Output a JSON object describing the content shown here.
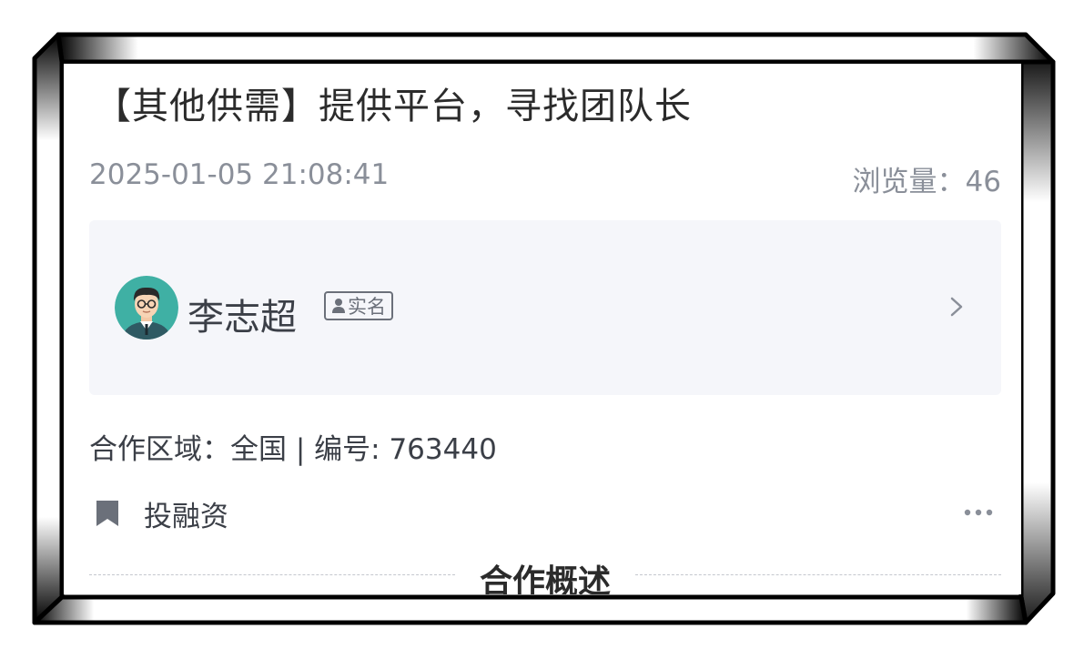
{
  "post": {
    "title": "【其他供需】提供平台，寻找团队长",
    "date": "2025-01-05 21:08:41",
    "views": "浏览量：46"
  },
  "author": {
    "name": "李志超",
    "badge": "实名"
  },
  "details": {
    "info_line": "合作区域：全国 | 编号: 763440",
    "tag": "投融资"
  },
  "section": {
    "title": "合作概述"
  },
  "icons": {
    "avatar": "avatar-cartoon-man",
    "badge": "person-icon",
    "chevron": "chevron-right-icon",
    "bookmark": "bookmark-icon",
    "more": "more-dots-icon"
  },
  "colors": {
    "card_background": "#f5f6fa",
    "meta_text": "#8a8f99",
    "primary_text": "#2b2b2b",
    "icon_gray": "#6b707a"
  }
}
